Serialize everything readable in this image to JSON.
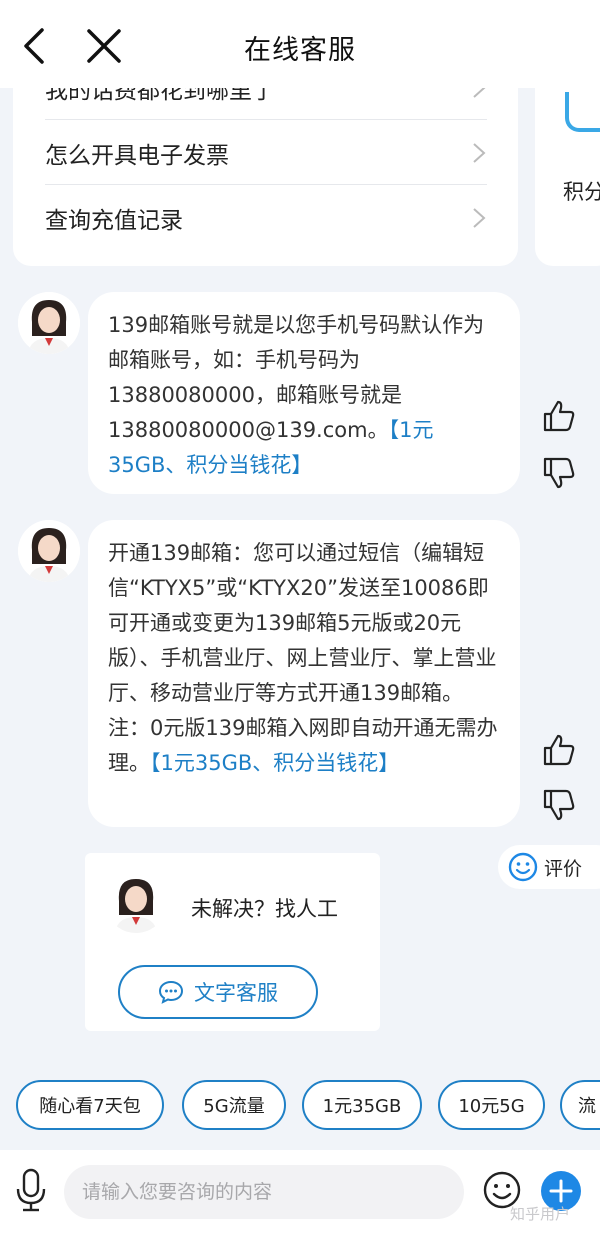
{
  "header": {
    "title": "在线客服"
  },
  "menu": {
    "items": [
      {
        "label": "我的话费都花到哪里了"
      },
      {
        "label": "怎么开具电子发票"
      },
      {
        "label": "查询充值记录"
      }
    ],
    "side_label": "积分"
  },
  "messages": [
    {
      "text": "139邮箱账号就是以您手机号码默认作为邮箱账号，如：手机号码为13880080000，邮箱账号就是13880080000@139.com。",
      "link": "【1元35GB、积分当钱花】"
    },
    {
      "text": "开通139邮箱：您可以通过短信（编辑短信“KTYX5”或“KTYX20”发送至10086即可开通或变更为139邮箱5元版或20元版）、手机营业厅、网上营业厅、掌上营业厅、移动营业厅等方式开通139邮箱。注：0元版139邮箱入网即自动开通无需办理。",
      "link": "【1元35GB、积分当钱花】"
    }
  ],
  "human": {
    "question": "未解决？找人工",
    "button": "文字客服"
  },
  "rating": {
    "label": "评价"
  },
  "chips": [
    "随心看7天包",
    "5G流量",
    "1元35GB",
    "10元5G",
    "流"
  ],
  "input": {
    "placeholder": "请输入您要咨询的内容"
  },
  "watermark": "知乎用户",
  "colors": {
    "accent": "#1f80c6",
    "background": "#f1f4f9",
    "link": "#1d7fc6"
  },
  "icons": [
    "back-icon",
    "close-icon",
    "chevron-right-icon",
    "thumbs-up-icon",
    "thumbs-down-icon",
    "smile-icon",
    "chat-bubble-icon",
    "microphone-icon",
    "emoji-icon",
    "plus-icon"
  ]
}
